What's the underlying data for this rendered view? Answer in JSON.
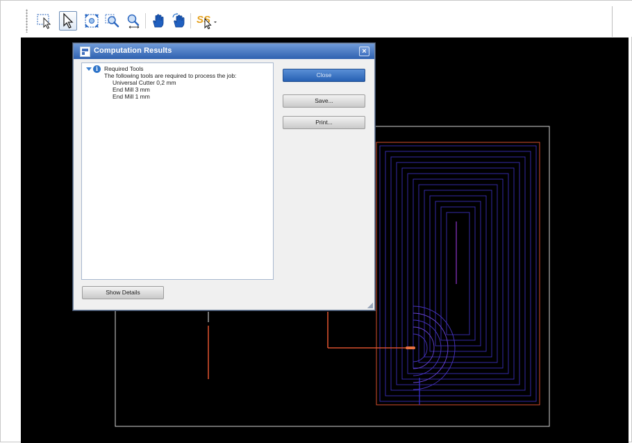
{
  "toolbar": {
    "tools": [
      {
        "name": "lasso-select-icon"
      },
      {
        "name": "select-arrow-icon",
        "active": true
      },
      {
        "name": "zoom-fit-icon"
      },
      {
        "name": "zoom-window-icon"
      },
      {
        "name": "zoom-pan-icon"
      },
      {
        "name": "hand-pan-icon"
      },
      {
        "name": "hand-rotate-icon"
      },
      {
        "name": "snap-options-icon"
      }
    ]
  },
  "dialog": {
    "title": "Computation Results",
    "close_glyph": "×",
    "tree": {
      "root_label": "Required Tools",
      "description": "The following tools are required to process the job:",
      "items": [
        "Universal Cutter 0,2 mm",
        "End Mill 3 mm",
        "End Mill 1 mm"
      ]
    },
    "buttons": {
      "close": "Close",
      "save": "Save...",
      "print": "Print...",
      "show_details": "Show Details"
    }
  },
  "colors": {
    "viewport_bg": "#000000",
    "board_outline": "#d8d8d8",
    "toolpath_blue": "#3a2fb8",
    "toolpath_red": "#d8502e",
    "dialog_title": "#2f61b0"
  }
}
